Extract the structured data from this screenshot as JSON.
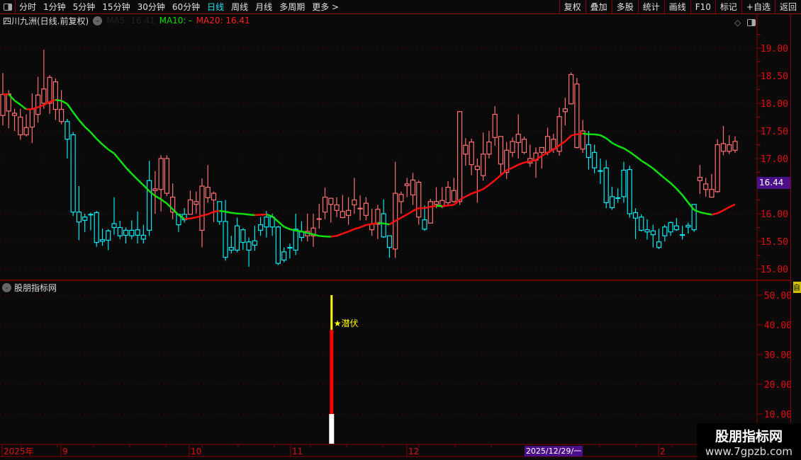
{
  "toolbar": {
    "periods": [
      "分时",
      "1分钟",
      "5分钟",
      "15分钟",
      "30分钟",
      "60分钟",
      "日线",
      "周线",
      "月线",
      "多周期",
      "更多 >"
    ],
    "active_period": "日线",
    "buttons": [
      "复权",
      "叠加",
      "多股",
      "统计",
      "画线",
      "F10",
      "标记",
      "+自选",
      "返回"
    ]
  },
  "header": {
    "title": "四川九洲(日线.前复权)",
    "ma5": "MA5: 16.41",
    "ma10": "MA10: -",
    "ma20": "MA20: 16.41"
  },
  "price_axis": {
    "ticks": [
      "19.00",
      "18.50",
      "18.00",
      "17.50",
      "17.00",
      "16.00",
      "15.50",
      "15.00"
    ],
    "current": "16.44"
  },
  "indicator": {
    "title": "股朋指标网",
    "ticks": [
      "50.00",
      "40.00",
      "30.00",
      "20.00",
      "10.00"
    ],
    "signal_label": "★潜伏",
    "side_tag": "自"
  },
  "date_axis": {
    "labels": [
      "2025年",
      "9",
      "10",
      "11",
      "12",
      "2",
      "2025/12/29/一"
    ]
  },
  "watermark": {
    "line1": "股朋指标网",
    "line2": "www.7gpzb.com"
  },
  "colors": {
    "up": "#ff7070",
    "down": "#00e8f0",
    "ma_up": "#ff1010",
    "ma_down": "#10e010",
    "grid": "#8b0000",
    "signal_low": "#ffffff",
    "signal_mid": "#ff0000",
    "signal_high": "#ffff00"
  },
  "chart_data": {
    "type": "candlestick",
    "ylim": [
      14.9,
      19.4
    ],
    "ohlc": [
      [
        17.78,
        18.55,
        17.6,
        18.16
      ],
      [
        17.86,
        18.24,
        17.55,
        18.17
      ],
      [
        17.78,
        17.9,
        17.5,
        17.82
      ],
      [
        17.43,
        17.9,
        17.34,
        17.75
      ],
      [
        17.43,
        17.8,
        17.4,
        17.56
      ],
      [
        17.57,
        18.18,
        17.28,
        17.9
      ],
      [
        17.8,
        18.48,
        17.65,
        18.15
      ],
      [
        18.0,
        18.97,
        17.9,
        18.26
      ],
      [
        18.0,
        18.51,
        17.81,
        18.47
      ],
      [
        17.89,
        18.45,
        17.7,
        18.39
      ],
      [
        17.67,
        18.24,
        17.62,
        17.89
      ],
      [
        17.67,
        17.72,
        17.0,
        17.35
      ],
      [
        17.43,
        17.48,
        15.96,
        16.03
      ],
      [
        16.03,
        16.5,
        15.52,
        15.85
      ],
      [
        15.94,
        16.0,
        15.67,
        15.88
      ],
      [
        15.99,
        16.02,
        15.7,
        15.98
      ],
      [
        16.02,
        16.05,
        15.4,
        15.48
      ],
      [
        15.53,
        15.73,
        15.42,
        15.5
      ],
      [
        15.69,
        15.72,
        15.34,
        15.52
      ],
      [
        15.82,
        16.3,
        15.62,
        15.75
      ],
      [
        15.75,
        15.87,
        15.54,
        15.6
      ],
      [
        15.7,
        15.75,
        15.46,
        15.61
      ],
      [
        15.7,
        15.88,
        15.54,
        15.6
      ],
      [
        15.71,
        16.04,
        15.46,
        15.61
      ],
      [
        15.61,
        15.8,
        15.46,
        15.54
      ],
      [
        16.6,
        16.96,
        15.6,
        15.7
      ],
      [
        16.42,
        16.77,
        16.0,
        16.45
      ],
      [
        16.44,
        17.06,
        16.04,
        17.0
      ],
      [
        16.37,
        17.06,
        16.32,
        17.0
      ],
      [
        16.03,
        16.55,
        15.9,
        16.3
      ],
      [
        15.99,
        16.0,
        15.67,
        15.8
      ],
      [
        15.99,
        16.1,
        15.84,
        15.89
      ],
      [
        15.99,
        16.42,
        15.99,
        16.25
      ],
      [
        16.17,
        16.4,
        16.0,
        16.22
      ],
      [
        15.7,
        16.64,
        15.39,
        16.5
      ],
      [
        16.29,
        16.88,
        16.2,
        16.48
      ],
      [
        16.25,
        16.4,
        15.85,
        16.37
      ],
      [
        16.22,
        16.22,
        15.8,
        15.86
      ],
      [
        15.86,
        16.25,
        15.15,
        15.21
      ],
      [
        15.39,
        15.6,
        15.28,
        15.34
      ],
      [
        15.78,
        15.93,
        15.3,
        15.34
      ],
      [
        15.71,
        15.74,
        15.35,
        15.48
      ],
      [
        15.49,
        15.57,
        15.04,
        15.34
      ],
      [
        15.51,
        15.78,
        15.33,
        15.43
      ],
      [
        15.8,
        15.94,
        15.6,
        15.7
      ],
      [
        15.94,
        16.05,
        15.57,
        15.76
      ],
      [
        15.94,
        16.0,
        15.6,
        15.76
      ],
      [
        15.76,
        15.78,
        15.07,
        15.1
      ],
      [
        15.31,
        15.39,
        15.12,
        15.16
      ],
      [
        15.39,
        15.46,
        15.19,
        15.38
      ],
      [
        15.72,
        16.0,
        15.25,
        15.34
      ],
      [
        15.67,
        15.86,
        15.5,
        15.57
      ],
      [
        15.6,
        16.0,
        15.5,
        15.68
      ],
      [
        15.6,
        16.0,
        15.4,
        15.74
      ],
      [
        15.9,
        16.18,
        15.73,
        15.91
      ],
      [
        16.03,
        16.47,
        15.9,
        16.3
      ],
      [
        16.17,
        16.28,
        15.84,
        16.28
      ],
      [
        16.06,
        16.3,
        15.94,
        16.16
      ],
      [
        15.93,
        16.34,
        15.92,
        16.04
      ],
      [
        15.97,
        16.3,
        15.8,
        16.06
      ],
      [
        16.16,
        16.65,
        16.0,
        16.25
      ],
      [
        16.1,
        16.33,
        15.88,
        16.1
      ],
      [
        15.97,
        16.3,
        15.88,
        16.19
      ],
      [
        15.71,
        16.09,
        15.6,
        15.81
      ],
      [
        15.81,
        16.16,
        15.54,
        16.08
      ],
      [
        16.0,
        16.26,
        15.56,
        15.58
      ],
      [
        15.6,
        15.6,
        15.2,
        15.39
      ],
      [
        15.36,
        16.94,
        15.2,
        16.37
      ],
      [
        16.22,
        16.4,
        16.0,
        16.35
      ],
      [
        16.51,
        16.65,
        16.3,
        16.54
      ],
      [
        16.34,
        16.74,
        16.16,
        16.61
      ],
      [
        15.94,
        16.6,
        15.8,
        16.57
      ],
      [
        15.89,
        16.15,
        15.69,
        15.72
      ],
      [
        15.83,
        16.27,
        15.83,
        16.22
      ],
      [
        16.17,
        16.48,
        16.1,
        16.22
      ],
      [
        16.13,
        16.48,
        16.1,
        16.24
      ],
      [
        16.2,
        16.59,
        16.16,
        16.48
      ],
      [
        16.22,
        16.65,
        16.2,
        16.42
      ],
      [
        16.22,
        17.85,
        16.16,
        17.85
      ],
      [
        17.08,
        17.37,
        16.87,
        17.24
      ],
      [
        16.89,
        17.36,
        16.7,
        17.3
      ],
      [
        16.8,
        17.0,
        16.2,
        16.86
      ],
      [
        16.69,
        17.47,
        16.6,
        17.08
      ],
      [
        17.08,
        17.5,
        17.0,
        17.3
      ],
      [
        17.38,
        17.95,
        17.23,
        17.8
      ],
      [
        16.9,
        17.4,
        16.71,
        17.4
      ],
      [
        16.75,
        17.3,
        16.63,
        17.15
      ],
      [
        17.11,
        17.38,
        17.03,
        17.31
      ],
      [
        17.29,
        17.8,
        17.0,
        17.44
      ],
      [
        17.11,
        17.4,
        17.08,
        17.35
      ],
      [
        16.92,
        17.25,
        16.85,
        17.0
      ],
      [
        16.97,
        17.2,
        16.65,
        17.1
      ],
      [
        17.11,
        17.2,
        16.82,
        17.2
      ],
      [
        17.11,
        17.56,
        17.06,
        17.4
      ],
      [
        17.17,
        17.45,
        17.1,
        17.35
      ],
      [
        17.13,
        17.92,
        17.05,
        17.76
      ],
      [
        17.85,
        18.1,
        17.6,
        17.9
      ],
      [
        17.99,
        18.56,
        17.98,
        18.52
      ],
      [
        17.2,
        18.46,
        17.18,
        18.35
      ],
      [
        17.17,
        17.7,
        17.1,
        17.5
      ],
      [
        17.25,
        17.5,
        16.8,
        17.02
      ],
      [
        17.11,
        17.25,
        16.73,
        16.83
      ],
      [
        16.78,
        17.0,
        16.54,
        16.77
      ],
      [
        16.83,
        16.97,
        16.1,
        16.2
      ],
      [
        16.31,
        16.49,
        16.07,
        16.11
      ],
      [
        16.29,
        16.46,
        16.2,
        16.28
      ],
      [
        16.79,
        16.94,
        16.2,
        16.31
      ],
      [
        16.8,
        16.87,
        15.93,
        16.0
      ],
      [
        16.02,
        16.1,
        15.54,
        15.92
      ],
      [
        15.94,
        15.99,
        15.68,
        15.7
      ],
      [
        15.71,
        15.9,
        15.53,
        15.67
      ],
      [
        15.69,
        15.8,
        15.39,
        15.62
      ],
      [
        15.49,
        15.73,
        15.36,
        15.39
      ],
      [
        15.76,
        15.8,
        15.5,
        15.6
      ],
      [
        15.84,
        15.86,
        15.6,
        15.67
      ],
      [
        15.78,
        15.92,
        15.69,
        15.71
      ],
      [
        15.62,
        15.78,
        15.53,
        15.61
      ],
      [
        15.79,
        15.84,
        15.64,
        15.76
      ],
      [
        16.17,
        16.17,
        15.67,
        15.71
      ],
      [
        16.6,
        16.88,
        16.36,
        16.66
      ],
      [
        16.44,
        16.65,
        16.31,
        16.54
      ],
      [
        16.3,
        16.72,
        16.3,
        16.44
      ],
      [
        16.4,
        17.35,
        16.38,
        17.25
      ],
      [
        17.13,
        17.59,
        17.06,
        17.27
      ],
      [
        17.13,
        17.42,
        17.08,
        17.25
      ],
      [
        17.15,
        17.4,
        17.1,
        17.31
      ]
    ],
    "ma_period": 20,
    "indicator_bar": {
      "candle_index": 56,
      "segments": [
        {
          "from": 0,
          "to": 10,
          "color": "white"
        },
        {
          "from": 10,
          "to": 38.3,
          "color": "red"
        },
        {
          "from": 38.3,
          "to": 50,
          "color": "yellow"
        }
      ]
    },
    "indicator_ylim": [
      0,
      55
    ]
  }
}
